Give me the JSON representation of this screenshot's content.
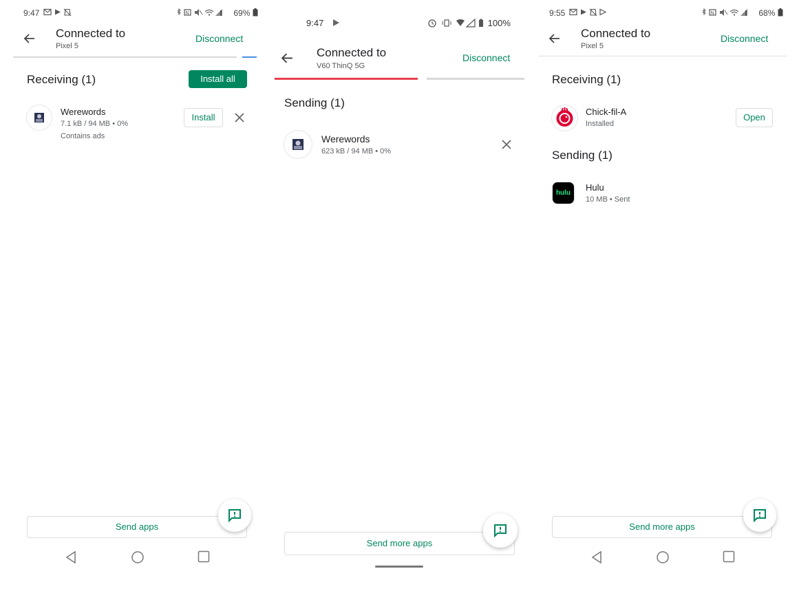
{
  "colors": {
    "accent": "#01875f",
    "progress_red": "#e8404f",
    "progress_blue": "#4a90e2"
  },
  "screen1": {
    "status": {
      "time": "9:47",
      "battery": "69%"
    },
    "header": {
      "title": "Connected to",
      "device": "Pixel 5",
      "disconnect": "Disconnect"
    },
    "section": "Receiving (1)",
    "install_all": "Install all",
    "app": {
      "name": "Werewords",
      "meta": "7.1 kB / 94 MB • 0%",
      "note": "Contains ads",
      "action": "Install"
    },
    "bottom_button": "Send apps"
  },
  "screen2": {
    "status": {
      "time": "9:47",
      "battery": "100%"
    },
    "header": {
      "title": "Connected to",
      "device": "V60 ThinQ 5G",
      "disconnect": "Disconnect"
    },
    "section": "Sending (1)",
    "app": {
      "name": "Werewords",
      "meta": "623 kB / 94 MB • 0%"
    },
    "bottom_button": "Send more apps"
  },
  "screen3": {
    "status": {
      "time": "9:55",
      "battery": "68%"
    },
    "header": {
      "title": "Connected to",
      "device": "Pixel 5",
      "disconnect": "Disconnect"
    },
    "receiving_section": "Receiving (1)",
    "receiving_app": {
      "name": "Chick-fil-A",
      "meta": "Installed",
      "action": "Open"
    },
    "sending_section": "Sending (1)",
    "sending_app": {
      "name": "Hulu",
      "meta": "10 MB • Sent",
      "logo_text": "hulu"
    },
    "bottom_button": "Send more apps"
  }
}
